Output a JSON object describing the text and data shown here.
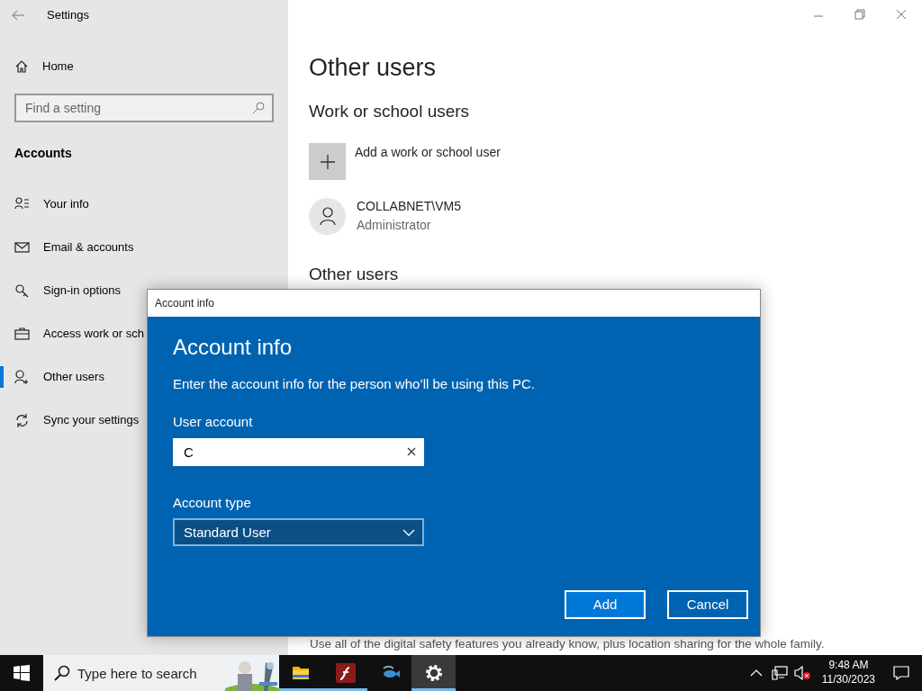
{
  "window": {
    "title": "Settings"
  },
  "sidebar": {
    "home": "Home",
    "search": {
      "placeholder": "Find a setting"
    },
    "section": "Accounts",
    "items": [
      {
        "label": "Your info",
        "selected": false
      },
      {
        "label": "Email & accounts",
        "selected": false
      },
      {
        "label": "Sign-in options",
        "selected": false
      },
      {
        "label": "Access work or sch",
        "selected": false
      },
      {
        "label": "Other users",
        "selected": true
      },
      {
        "label": "Sync your settings",
        "selected": false
      }
    ]
  },
  "content": {
    "title": "Other users",
    "section": "Work or school users",
    "add_label": "Add a work or school user",
    "account": {
      "name": "COLLABNET\\VM5",
      "role": "Administrator"
    },
    "other_heading": "Other users",
    "family_text": "Use all of the digital safety features you already know, plus location sharing for the whole family."
  },
  "dialog": {
    "title": "Account info",
    "heading": "Account info",
    "description": "Enter the account info for the person who’ll be using this PC.",
    "user_account_label": "User account",
    "user_account_value": "C",
    "account_type_label": "Account type",
    "account_type_value": "Standard User",
    "buttons": [
      "Add",
      "Cancel"
    ]
  },
  "taskbar": {
    "search": {
      "placeholder": "Type here to search"
    },
    "apps": [
      {
        "kind": "folder",
        "running": true,
        "selected": false
      },
      {
        "kind": "flash",
        "running": true,
        "selected": false
      },
      {
        "kind": "fish",
        "running": false,
        "selected": false
      },
      {
        "kind": "gear",
        "running": true,
        "selected": true
      }
    ],
    "time": "9:48 AM",
    "date": "11/30/2023"
  }
}
